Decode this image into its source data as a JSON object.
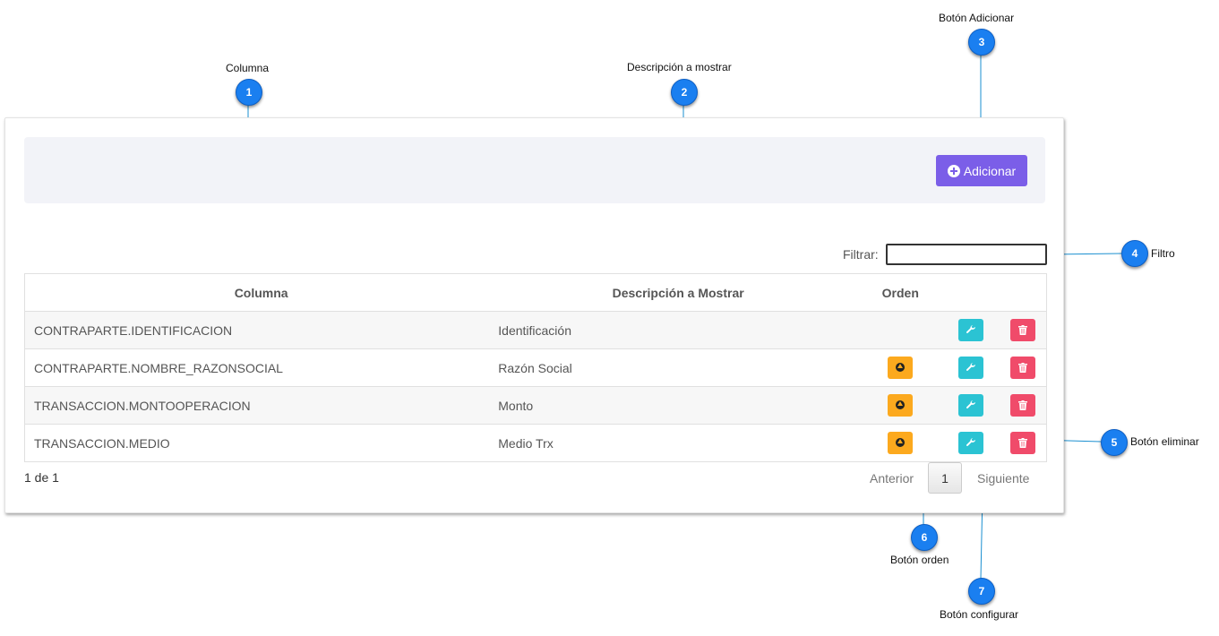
{
  "toolbar": {
    "add_label": "Adicionar"
  },
  "filter": {
    "label": "Filtrar:",
    "value": ""
  },
  "table": {
    "headers": [
      "Columna",
      "Descripción a Mostrar",
      "Orden"
    ],
    "rows": [
      {
        "column": "CONTRAPARTE.IDENTIFICACION",
        "description": "Identificación"
      },
      {
        "column": "CONTRAPARTE.NOMBRE_RAZONSOCIAL",
        "description": "Razón Social"
      },
      {
        "column": "TRANSACCION.MONTOOPERACION",
        "description": "Monto"
      },
      {
        "column": "TRANSACCION.MEDIO",
        "description": "Medio Trx"
      }
    ]
  },
  "pagination": {
    "info": "1 de 1",
    "prev": "Anterior",
    "page": "1",
    "next": "Siguiente"
  },
  "callouts": [
    {
      "num": "1",
      "label": "Columna"
    },
    {
      "num": "2",
      "label": "Descripción a mostrar"
    },
    {
      "num": "3",
      "label": "Botón  Adicionar"
    },
    {
      "num": "4",
      "label": "Filtro"
    },
    {
      "num": "5",
      "label": "Botón eliminar"
    },
    {
      "num": "6",
      "label": "Botón orden"
    },
    {
      "num": "7",
      "label": "Botón configurar"
    }
  ],
  "colors": {
    "accent": "#1a7ff0",
    "add_button": "#7b5ee8",
    "order_button": "#fca91e",
    "config_button": "#2bc3d3",
    "delete_button": "#f04b6a"
  }
}
